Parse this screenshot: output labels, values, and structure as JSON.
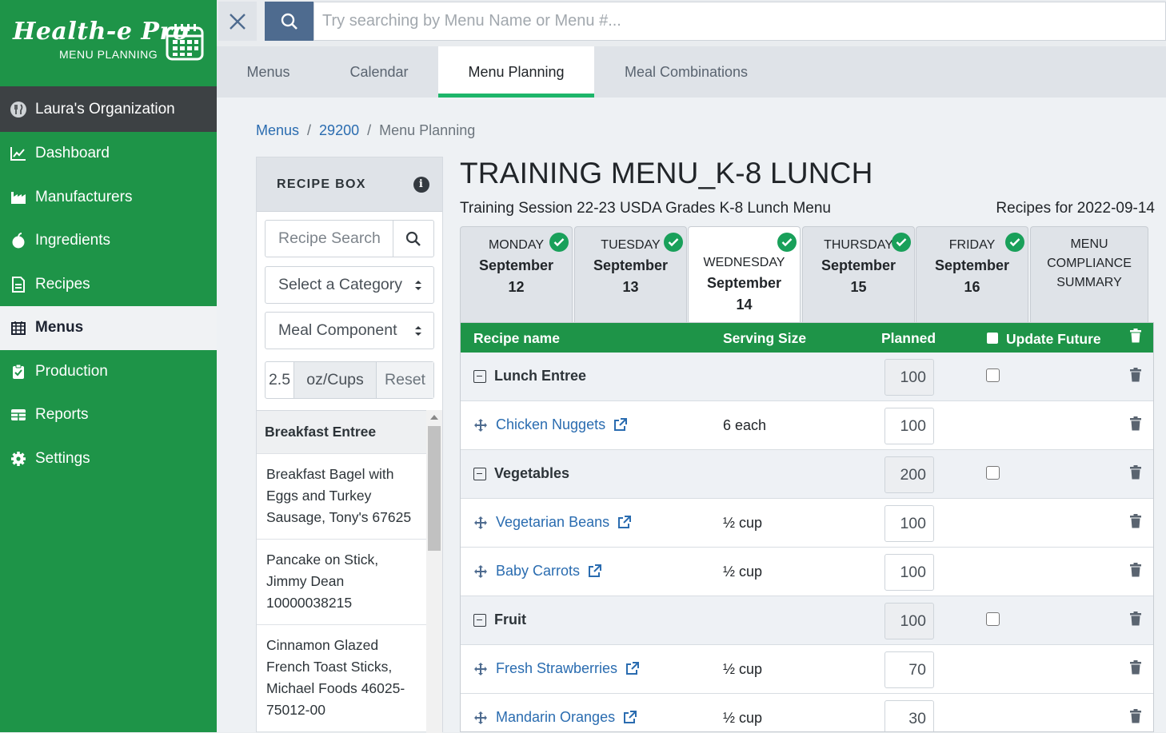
{
  "brand": {
    "name": "Health-e Pro",
    "subtitle": "MENU PLANNING"
  },
  "org": {
    "name": "Laura's Organization"
  },
  "sidebar": {
    "items": [
      {
        "label": "Dashboard",
        "icon": "chart-line-icon"
      },
      {
        "label": "Manufacturers",
        "icon": "industry-icon"
      },
      {
        "label": "Ingredients",
        "icon": "apple-icon"
      },
      {
        "label": "Recipes",
        "icon": "file-icon"
      },
      {
        "label": "Menus",
        "icon": "calendar-icon",
        "active": true
      },
      {
        "label": "Production",
        "icon": "clipboard-check-icon"
      },
      {
        "label": "Reports",
        "icon": "table-icon"
      },
      {
        "label": "Settings",
        "icon": "gear-icon"
      }
    ]
  },
  "search": {
    "placeholder": "Try searching by Menu Name or Menu #..."
  },
  "tabs": [
    {
      "label": "Menus"
    },
    {
      "label": "Calendar"
    },
    {
      "label": "Menu Planning",
      "active": true
    },
    {
      "label": "Meal Combinations"
    }
  ],
  "breadcrumb": {
    "items": [
      "Menus",
      "29200",
      "Menu Planning"
    ],
    "separator": "/"
  },
  "recipe_box": {
    "title": "RECIPE BOX",
    "search_placeholder": "Recipe Search",
    "category_select": "Select a Category",
    "component_select": "Meal Component",
    "portion_value": "2.5",
    "portion_unit": "oz/Cups",
    "reset_label": "Reset",
    "category": "Breakfast Entree",
    "items": [
      "Breakfast Bagel with Eggs and Turkey Sausage, Tony's 67625",
      "Pancake on Stick, Jimmy Dean 10000038215",
      "Cinnamon Glazed French Toast Sticks, Michael Foods 46025-75012-00"
    ]
  },
  "menu": {
    "title": "TRAINING MENU_K-8 LUNCH",
    "subtitle": "Training Session 22-23 USDA Grades K-8 Lunch Menu",
    "recipes_for": "Recipes for 2022-09-14"
  },
  "days": [
    {
      "day": "MONDAY",
      "month": "September",
      "date": "12",
      "complete": true
    },
    {
      "day": "TUESDAY",
      "month": "September",
      "date": "13",
      "complete": true
    },
    {
      "day": "WEDNESDAY",
      "month": "September",
      "date": "14",
      "complete": true,
      "active": true
    },
    {
      "day": "THURSDAY",
      "month": "September",
      "date": "15",
      "complete": true
    },
    {
      "day": "FRIDAY",
      "month": "September",
      "date": "16",
      "complete": true
    }
  ],
  "summary_tab": {
    "line1": "MENU",
    "line2": "COMPLIANCE",
    "line3": "SUMMARY"
  },
  "grid": {
    "headers": {
      "recipe": "Recipe name",
      "serving": "Serving Size",
      "planned": "Planned",
      "update": "Update Future"
    },
    "rows": [
      {
        "type": "category",
        "name": "Lunch Entree",
        "planned": "100"
      },
      {
        "type": "recipe",
        "name": "Chicken Nuggets",
        "serving": "6 each",
        "planned": "100"
      },
      {
        "type": "category",
        "name": "Vegetables",
        "planned": "200"
      },
      {
        "type": "recipe",
        "name": "Vegetarian Beans",
        "serving": "½ cup",
        "planned": "100"
      },
      {
        "type": "recipe",
        "name": "Baby Carrots",
        "serving": "½ cup",
        "planned": "100"
      },
      {
        "type": "category",
        "name": "Fruit",
        "planned": "100"
      },
      {
        "type": "recipe",
        "name": "Fresh Strawberries",
        "serving": "½ cup",
        "planned": "70"
      },
      {
        "type": "recipe",
        "name": "Mandarin Oranges",
        "serving": "½ cup",
        "planned": "30"
      }
    ]
  },
  "colors": {
    "brand_green": "#1e9448",
    "accent_green": "#1db56a",
    "link_blue": "#2a6cb0",
    "search_blue": "#4e6b8f"
  }
}
